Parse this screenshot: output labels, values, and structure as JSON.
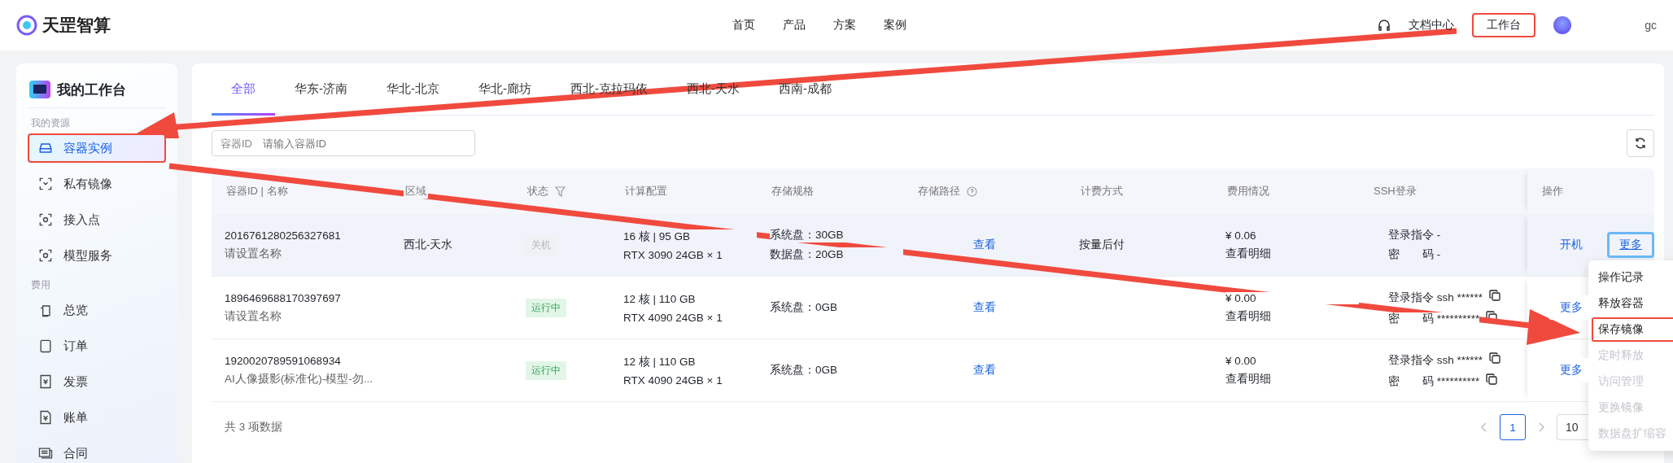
{
  "header": {
    "brand": "天罡智算",
    "nav": [
      {
        "label": "首页"
      },
      {
        "label": "产品"
      },
      {
        "label": "方案"
      },
      {
        "label": "案例"
      }
    ],
    "docs": "文档中心",
    "workbench": {
      "label": "工作台",
      "highlighted": true
    },
    "user": "gc"
  },
  "sidebar": {
    "title": "我的工作台",
    "sections": [
      {
        "title": "我的资源",
        "items": [
          {
            "label": "容器实例",
            "selected": true,
            "highlighted": true
          },
          {
            "label": "私有镜像",
            "selected": false,
            "highlighted": false
          },
          {
            "label": "接入点",
            "selected": false,
            "highlighted": false
          },
          {
            "label": "模型服务",
            "selected": false,
            "highlighted": false
          }
        ]
      },
      {
        "title": "费用",
        "items": [
          {
            "label": "总览",
            "selected": false,
            "highlighted": false
          },
          {
            "label": "订单",
            "selected": false,
            "highlighted": false
          },
          {
            "label": "发票",
            "selected": false,
            "highlighted": false
          },
          {
            "label": "账单",
            "selected": false,
            "highlighted": false
          },
          {
            "label": "合同",
            "selected": false,
            "highlighted": false
          }
        ]
      }
    ]
  },
  "tabs": [
    {
      "label": "全部",
      "selected": true
    },
    {
      "label": "华东-济南",
      "selected": false
    },
    {
      "label": "华北-北京",
      "selected": false
    },
    {
      "label": "华北-廊坊",
      "selected": false
    },
    {
      "label": "西北-克拉玛依",
      "selected": false
    },
    {
      "label": "西北-天水",
      "selected": false
    },
    {
      "label": "西南-成都",
      "selected": false
    }
  ],
  "search": {
    "label": "容器ID",
    "placeholder": "请输入容器ID"
  },
  "table": {
    "columns": [
      "容器ID | 名称",
      "区域",
      "状态",
      "计算配置",
      "存储规格",
      "存储路径",
      "计费方式",
      "费用情况",
      "SSH登录",
      "操作"
    ],
    "rows": [
      {
        "id": "2016761280256327681",
        "name": "请设置名称",
        "region": "西北-天水",
        "status": {
          "label": "关机",
          "kind": "stopped"
        },
        "compute": [
          "16 核 | 95 GB",
          "RTX 3090 24GB × 1"
        ],
        "storage": [
          "系统盘：30GB",
          "数据盘：20GB"
        ],
        "path": "查看",
        "billing": "按量后付",
        "fee": "¥ 0.06",
        "fee_detail": "查看明细",
        "ssh": [
          {
            "text": "登录指令 -",
            "copyable": false
          },
          {
            "text": "密　　码 -",
            "copyable": false
          }
        ],
        "actions": [
          {
            "label": "开机",
            "focused": false
          },
          {
            "label": "更多",
            "focused": true
          }
        ],
        "hovered": true
      },
      {
        "id": "1896469688170397697",
        "name": "请设置名称",
        "region": "",
        "status": {
          "label": "运行中",
          "kind": "running"
        },
        "compute": [
          "12 核 | 110 GB",
          "RTX 4090 24GB × 1"
        ],
        "storage": [
          "系统盘：0GB"
        ],
        "path": "查看",
        "billing": "",
        "fee": "¥ 0.00",
        "fee_detail": "查看明细",
        "ssh": [
          {
            "text": "登录指令 ssh ******",
            "copyable": true
          },
          {
            "text": "密　　码 **********",
            "copyable": true
          }
        ],
        "actions": [
          {
            "label": "更多",
            "focused": false
          }
        ],
        "hovered": false
      },
      {
        "id": "1920020789591068934",
        "name": "AI人像摄影(标准化)-模型-勿...",
        "region": "",
        "status": {
          "label": "运行中",
          "kind": "running"
        },
        "compute": [
          "12 核 | 110 GB",
          "RTX 4090 24GB × 1"
        ],
        "storage": [
          "系统盘：0GB"
        ],
        "path": "查看",
        "billing": "",
        "fee": "¥ 0.00",
        "fee_detail": "查看明细",
        "ssh": [
          {
            "text": "登录指令 ssh ******",
            "copyable": true
          },
          {
            "text": "密　　码 **********",
            "copyable": true
          }
        ],
        "actions": [
          {
            "label": "更多",
            "focused": false
          }
        ],
        "hovered": false
      }
    ]
  },
  "footer": {
    "total": "共 3 项数据",
    "pages": [
      {
        "label": "1",
        "selected": true
      }
    ],
    "page_size": "10"
  },
  "menu": [
    {
      "label": "操作记录",
      "disabled": false,
      "highlighted": false
    },
    {
      "label": "释放容器",
      "disabled": false,
      "highlighted": false
    },
    {
      "label": "保存镜像",
      "disabled": false,
      "highlighted": true
    },
    {
      "label": "定时释放",
      "disabled": true,
      "highlighted": false
    },
    {
      "label": "访问管理",
      "disabled": true,
      "highlighted": false
    },
    {
      "label": "更换镜像",
      "disabled": true,
      "highlighted": false
    },
    {
      "label": "数据盘扩缩容",
      "disabled": true,
      "highlighted": false
    }
  ]
}
